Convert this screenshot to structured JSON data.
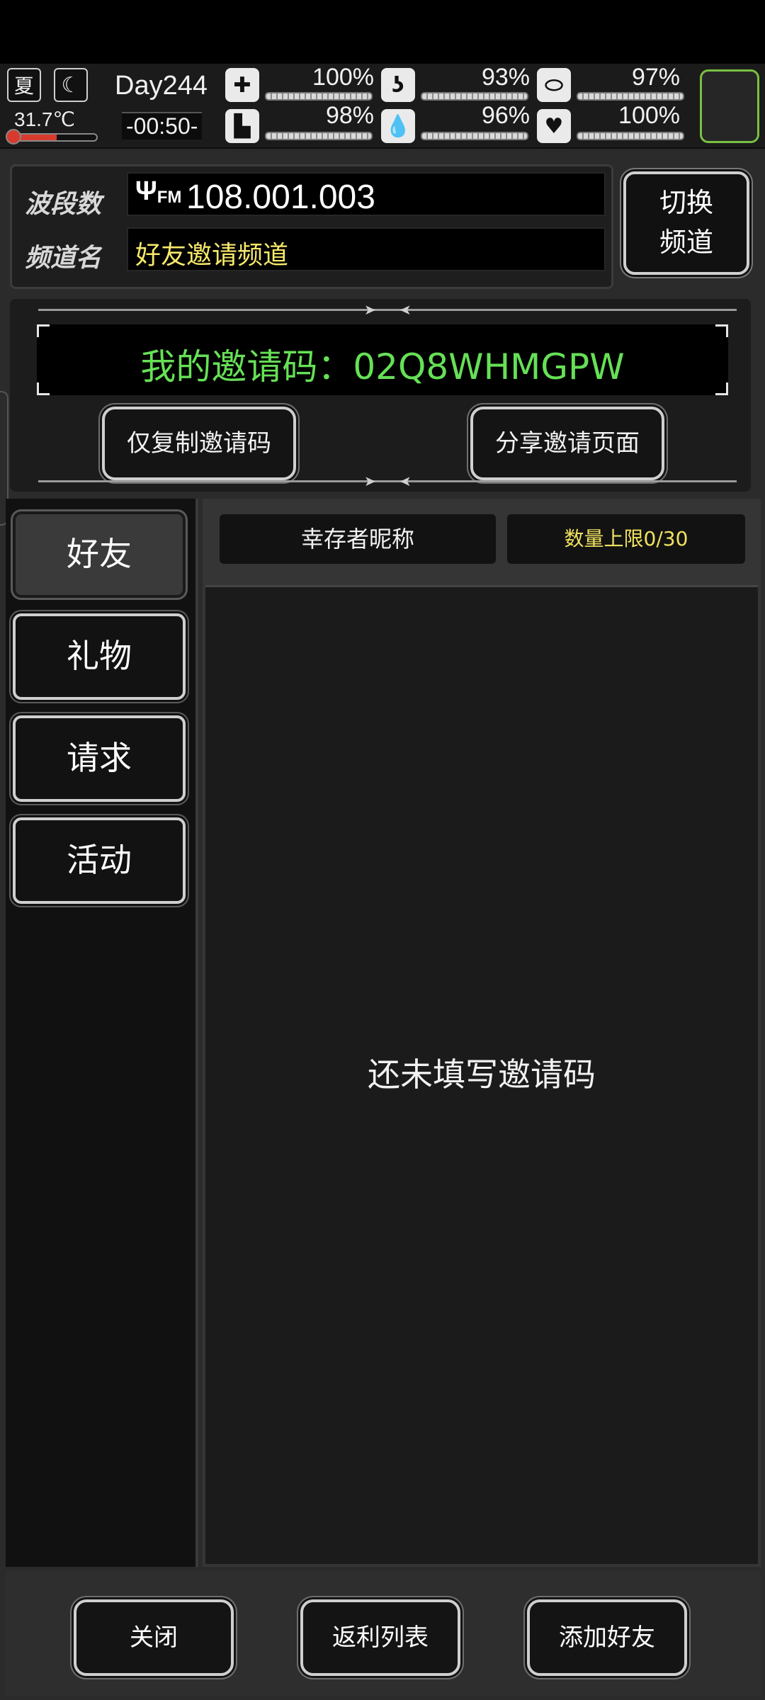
{
  "hud": {
    "season": "夏",
    "temperature": "31.7℃",
    "day": "Day244",
    "time": "-00:50-",
    "stats": [
      {
        "icon": "medkit-icon",
        "value": "100%"
      },
      {
        "icon": "stomach-icon",
        "value": "93%"
      },
      {
        "icon": "pill-icon",
        "value": "97%"
      },
      {
        "icon": "foot-icon",
        "value": "98%"
      },
      {
        "icon": "water-drop-icon",
        "value": "96%"
      },
      {
        "icon": "heart-icon",
        "value": "100%"
      }
    ]
  },
  "radio": {
    "band_label": "波段数",
    "band_icon": "FM",
    "band_value": "108.001.003",
    "channel_label": "频道名",
    "channel_value": "好友邀请频道",
    "switch_line1": "切换",
    "switch_line2": "频道"
  },
  "invite": {
    "code_text": "我的邀请码：02Q8WHMGPW",
    "copy_button": "仅复制邀请码",
    "share_button": "分享邀请页面"
  },
  "tabs": [
    "好友",
    "礼物",
    "请求",
    "活动"
  ],
  "list": {
    "col_name": "幸存者昵称",
    "col_limit": "数量上限0/30",
    "empty_message": "还未填写邀请码"
  },
  "footer": {
    "close": "关闭",
    "rebate_list": "返利列表",
    "add_friend": "添加好友"
  },
  "colors": {
    "accent_green": "#66e056",
    "channel_yellow": "#f7e96b",
    "limit_yellow": "#f0e260",
    "slot_green": "#7ac043"
  }
}
